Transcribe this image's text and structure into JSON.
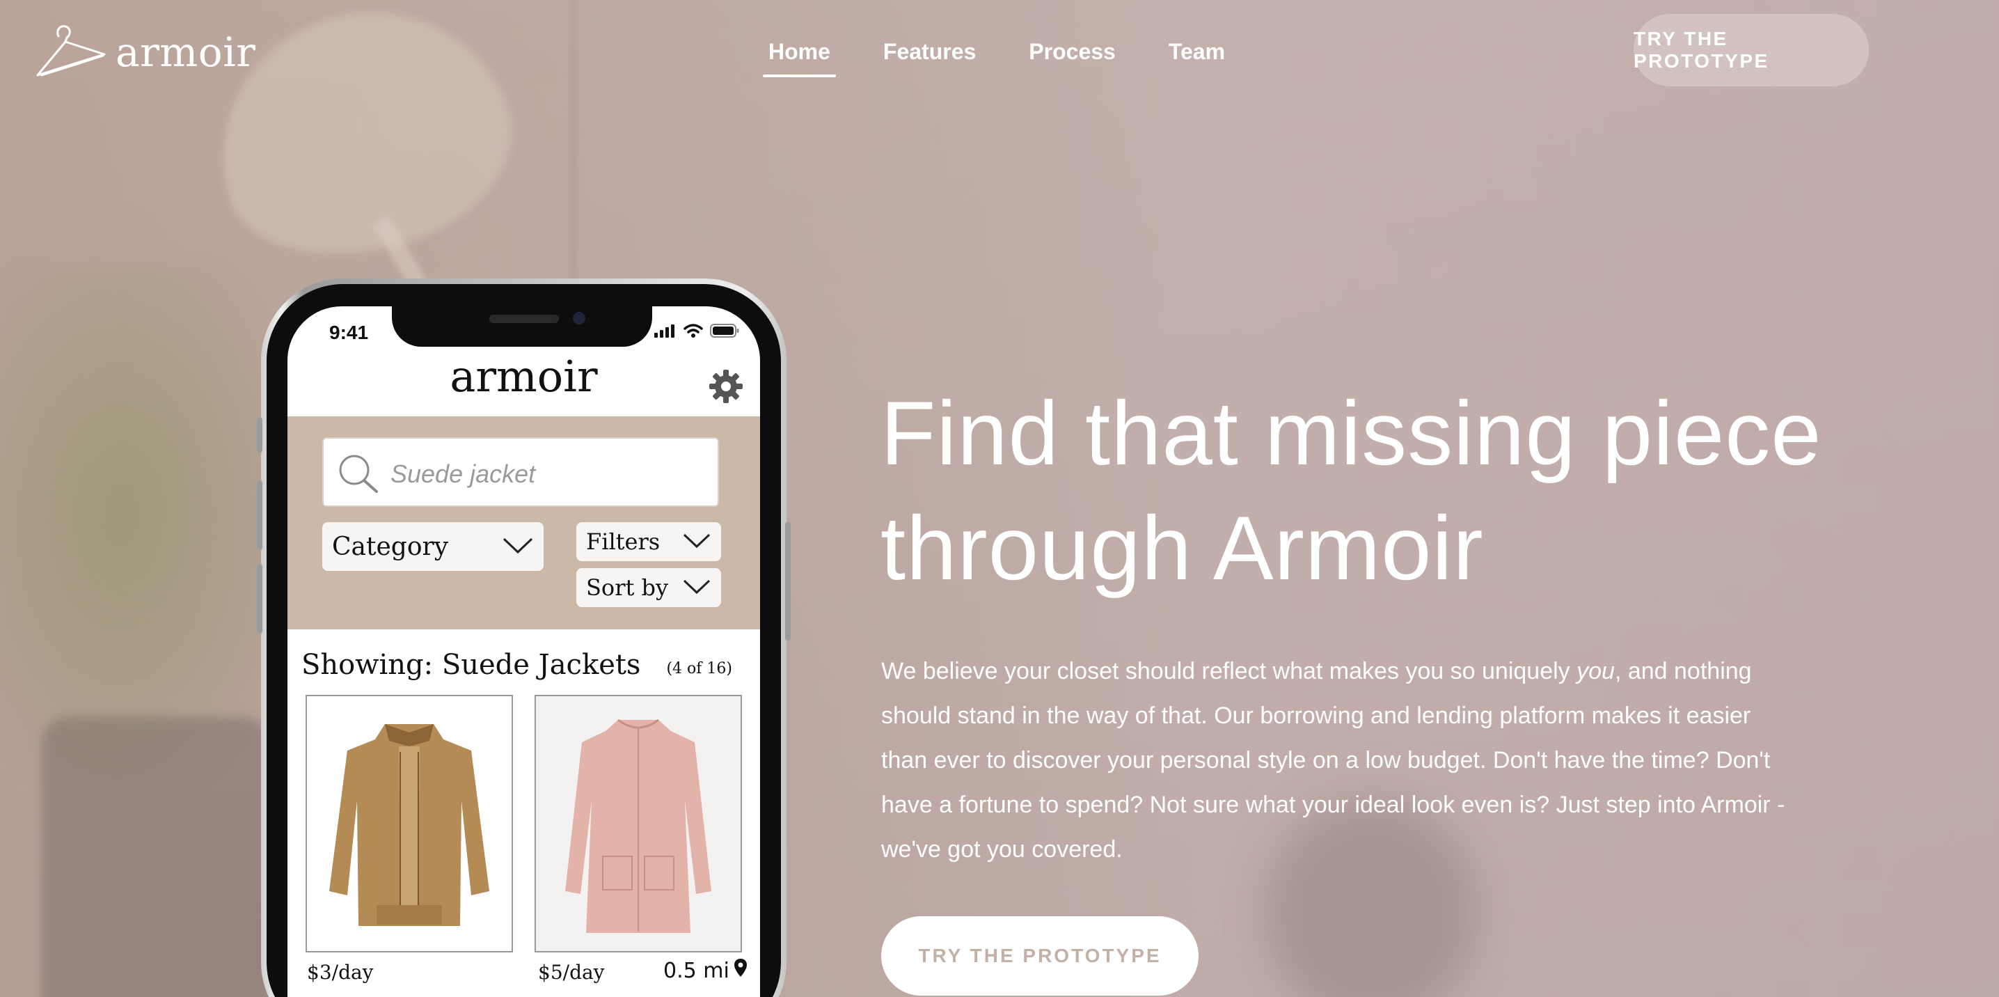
{
  "brand": {
    "name": "armoir",
    "logo_icon": "hanger-icon"
  },
  "nav": {
    "items": [
      {
        "label": "Home",
        "active": true
      },
      {
        "label": "Features",
        "active": false
      },
      {
        "label": "Process",
        "active": false
      },
      {
        "label": "Team",
        "active": false
      }
    ],
    "cta_label": "TRY THE PROTOTYPE"
  },
  "phone": {
    "status_time": "9:41",
    "app_title": "armoir",
    "search_placeholder": "Suede jacket",
    "category_label": "Category",
    "filters_label": "Filters",
    "sort_label": "Sort by",
    "results_title": "Showing: Suede Jackets",
    "results_count": "(4 of 16)",
    "products": [
      {
        "price": "$3/day",
        "image": "tan-suede-jacket"
      },
      {
        "price": "$5/day",
        "distance": "0.5 mi",
        "image": "pink-suede-coat"
      }
    ],
    "search_panel_color": "#cbb8a7"
  },
  "hero": {
    "heading_line1": "Find that missing piece",
    "heading_line2": "through Armoir",
    "body_part1": "We believe your closet should reflect what makes you so uniquely ",
    "body_emphasis": "you",
    "body_part2": ", and nothing should stand in the way of that. Our borrowing and lending platform makes it easier than ever to discover your personal style on a low budget. Don't have the time? Don't have a fortune to spend? Not sure what your ideal look even is? Just step into Armoir - we've got you covered.",
    "cta_label": "TRY THE PROTOTYPE"
  },
  "colors": {
    "background": "#bea9a2",
    "cta_text": "#c4b0a4",
    "text": "#ffffff"
  }
}
